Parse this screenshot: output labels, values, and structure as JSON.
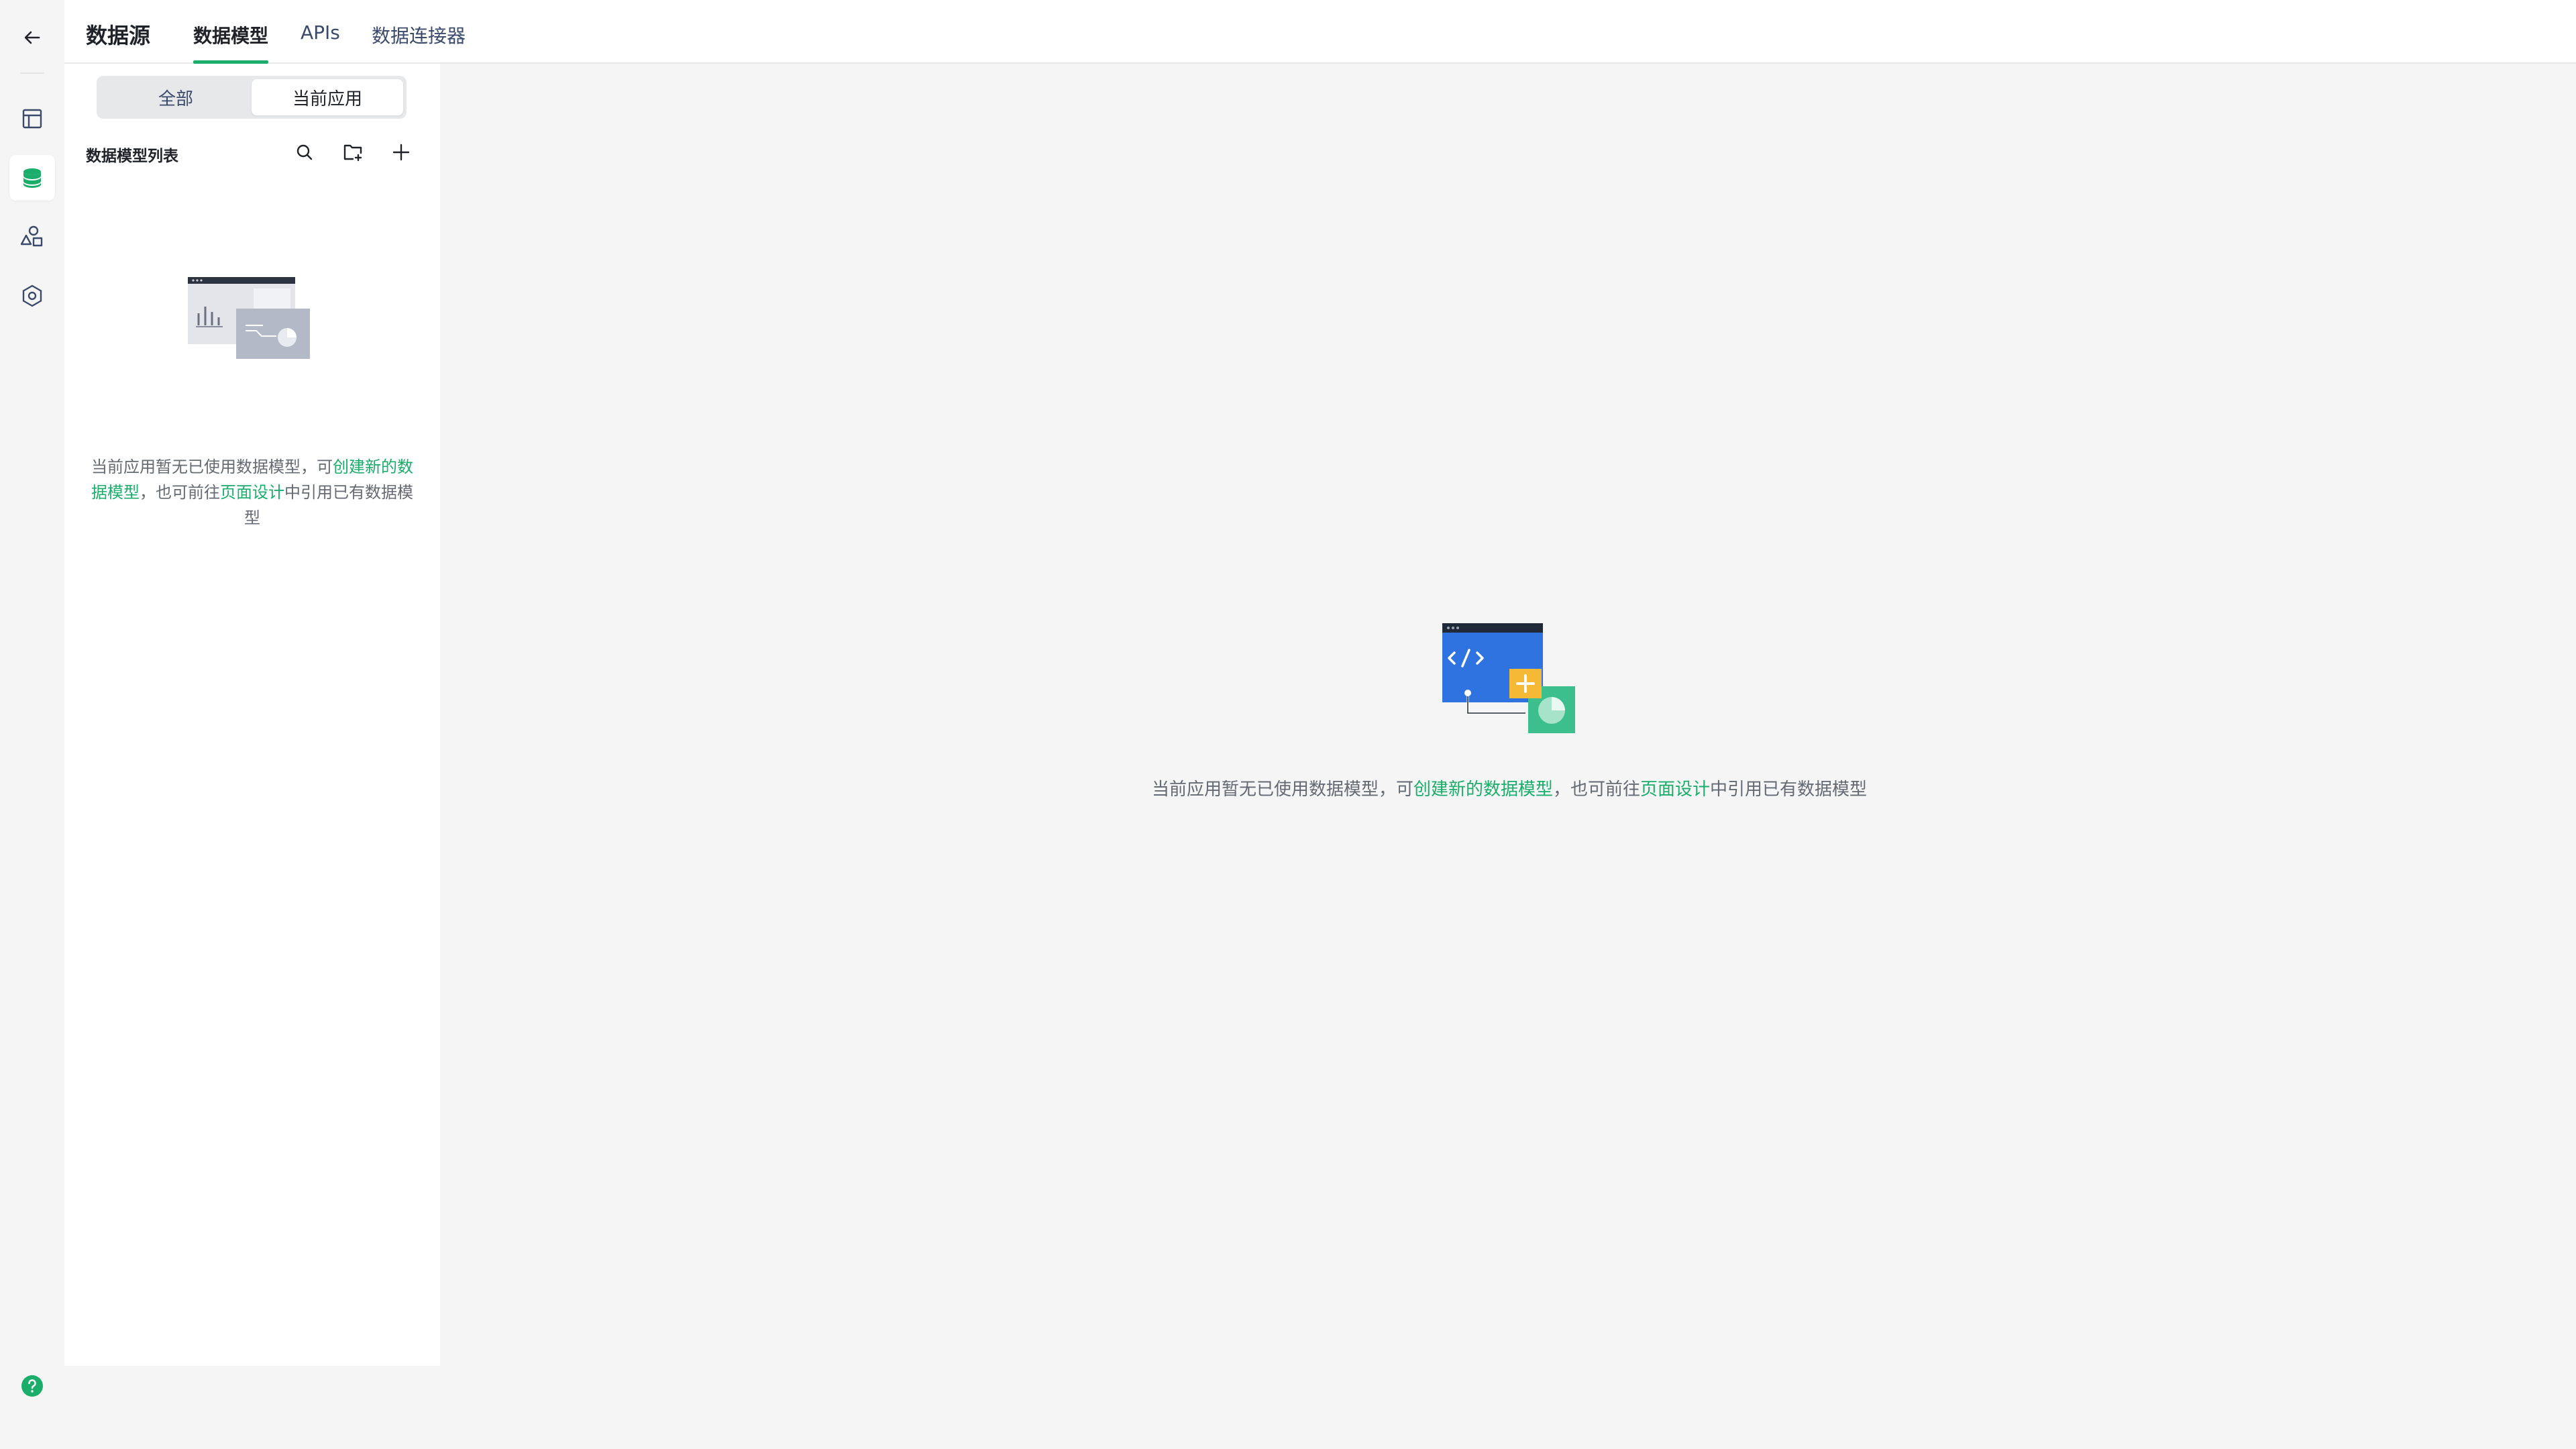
{
  "header": {
    "brand": "数据源",
    "tabs": [
      {
        "label": "数据模型",
        "active": true
      },
      {
        "label": "APIs",
        "active": false
      },
      {
        "label": "数据连接器",
        "active": false
      }
    ]
  },
  "rail": {
    "items": [
      "back-arrow-icon",
      "layout-icon",
      "database-icon",
      "shapes-icon",
      "hexagon-settings-icon"
    ],
    "help_icon": "help-icon",
    "active_index": 2
  },
  "panel": {
    "segment": {
      "all": "全部",
      "current": "当前应用",
      "selected": "current"
    },
    "list_title": "数据模型列表",
    "tools": [
      "search-icon",
      "folder-add-icon",
      "plus-icon"
    ],
    "empty": {
      "text_before": "当前应用暂无已使用数据模型，可",
      "link_create": "创建新的数据模型",
      "text_middle": "，也可前往",
      "link_page": "页面设计",
      "text_after": "中引用已有数据模型"
    }
  },
  "main": {
    "empty": {
      "text_before": "当前应用暂无已使用数据模型，可",
      "link_create": "创建新的数据模型",
      "text_middle": "，也可前往",
      "link_page": "页面设计",
      "text_after": "中引用已有数据模型"
    }
  },
  "colors": {
    "accent": "#1bad6a",
    "text_secondary": "#646a73",
    "background": "#f5f5f5"
  }
}
